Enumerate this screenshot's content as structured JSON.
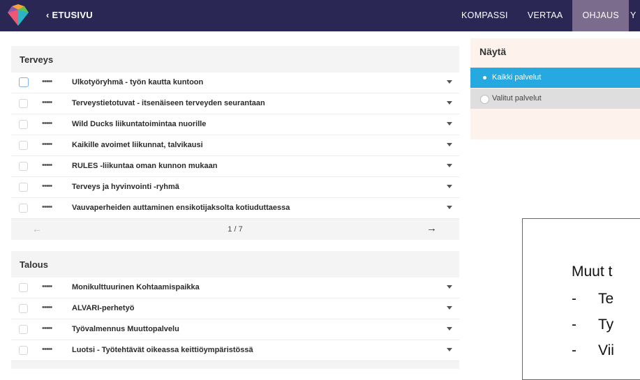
{
  "header": {
    "back_label": "‹ ETUSIVU",
    "nav": [
      "KOMPASSI",
      "VERTAA",
      "OHJAUS",
      "Y"
    ],
    "active_nav": "OHJAUS",
    "colors": {
      "bar": "#2a2755",
      "active": "#7b6b8d"
    }
  },
  "sections": [
    {
      "title": "Terveys",
      "items": [
        {
          "dots": "•••••",
          "title": "Ulkotyöryhmä - työn kautta kuntoon"
        },
        {
          "dots": "•••••",
          "title": "Terveystietotuvat - itsenäiseen terveyden seurantaan"
        },
        {
          "dots": "•••••",
          "title": "Wild Ducks liikuntatoimintaa nuorille"
        },
        {
          "dots": "•••••",
          "title": "Kaikille avoimet liikunnat, talvikausi"
        },
        {
          "dots": "•••••",
          "title": "RULES -liikuntaa oman kunnon mukaan"
        },
        {
          "dots": "•••••",
          "title": "Terveys ja hyvinvointi -ryhmä"
        },
        {
          "dots": "•••••",
          "title": "Vauvaperheiden auttaminen ensikotijaksolta kotiuduttaessa"
        }
      ],
      "pager": {
        "prev": "←",
        "page": "1 / 7",
        "next": "→"
      }
    },
    {
      "title": "Talous",
      "items": [
        {
          "dots": "•••••",
          "title": "Monikulttuurinen Kohtaamispaikka"
        },
        {
          "dots": "•••••",
          "title": "ALVARI-perhetyö"
        },
        {
          "dots": "•••••",
          "title": "Työvalmennus Muuttopalvelu"
        },
        {
          "dots": "•••••",
          "title": "Luotsi - Työtehtävät oikeassa keittiöympäristössä"
        }
      ]
    }
  ],
  "show": {
    "title": "Näytä",
    "options": [
      "Kaikki palvelut",
      "Valitut palvelut"
    ],
    "selected_color": "#26a8e1"
  },
  "overlay": {
    "title": "Muut t",
    "items": [
      {
        "dash": "-",
        "text": "Te"
      },
      {
        "dash": "-",
        "text": "Ty"
      },
      {
        "dash": "-",
        "text": "Vii"
      }
    ]
  }
}
